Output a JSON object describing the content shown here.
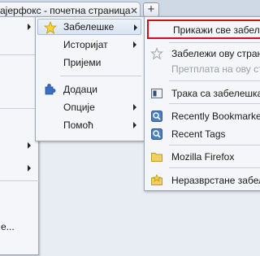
{
  "tab": {
    "title": "ајерфокс - почетна страница",
    "new_tab_symbol": "+"
  },
  "main_menu": {
    "partial_item_label": "е..."
  },
  "tools_menu": {
    "items": [
      {
        "label": "Забелешке",
        "icon": "star-icon",
        "submenu": true,
        "active": true
      },
      {
        "label": "Историјат",
        "submenu": true
      },
      {
        "label": "Пријеми",
        "submenu": false
      },
      {
        "label": "Додаци",
        "icon": "puzzle-piece-icon",
        "submenu": false
      },
      {
        "label": "Опције",
        "submenu": true
      },
      {
        "label": "Помоћ",
        "submenu": true
      }
    ]
  },
  "bookmarks_menu": {
    "items": [
      {
        "label": "Прикажи све забелешке",
        "icon": "",
        "highlighted": true
      },
      {
        "label": "Забележи ову страницу",
        "icon": "star-outline-icon"
      },
      {
        "label": "Претплата на ову страницу",
        "disabled": true
      },
      {
        "label": "Трака са забелешкама",
        "icon": "bookmark-toolbar-icon"
      },
      {
        "label": "Recently Bookmarked",
        "icon": "smart-folder-icon"
      },
      {
        "label": "Recent Tags",
        "icon": "smart-folder-icon"
      },
      {
        "label": "Mozilla Firefox",
        "icon": "folder-icon"
      },
      {
        "label": "Неразврстане забелешке",
        "icon": "unsorted-bookmarks-icon"
      }
    ]
  },
  "colors": {
    "highlight_border": "#d0101a",
    "menu_background": "#f4f6f9",
    "menu_border": "#9fa9b8"
  }
}
